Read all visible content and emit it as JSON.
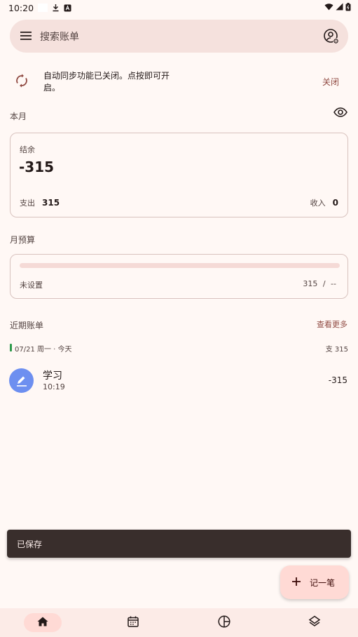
{
  "status_bar": {
    "time": "10:20",
    "icons": [
      "download-icon",
      "a-box-icon"
    ],
    "right_icons": [
      "wifi-icon",
      "signal-icon",
      "battery-icon"
    ]
  },
  "search": {
    "placeholder": "搜索账单",
    "menu_icon": "menu-icon",
    "account_icon": "account-settings-icon"
  },
  "sync_banner": {
    "message": "自动同步功能已关闭。点按即可开启。",
    "close_label": "关闭",
    "icon": "sync-icon"
  },
  "this_month": {
    "label": "本月",
    "balance_label": "结余",
    "balance": "-315",
    "expense_label": "支出",
    "expense": "315",
    "income_label": "收入",
    "income": "0",
    "eye_icon": "eye-icon"
  },
  "budget": {
    "label": "月预算",
    "status": "未设置",
    "ratio": "315 / --",
    "progress_fraction": 0
  },
  "recent": {
    "label": "近期账单",
    "more_label": "查看更多",
    "day_date": "07/21 周一 · 今天",
    "day_total": "支 315",
    "records": [
      {
        "title": "学习",
        "time": "10:19",
        "amount": "-315",
        "icon": "edit-icon"
      }
    ]
  },
  "snackbar": {
    "text": "已保存"
  },
  "fab": {
    "label": "记一笔",
    "icon": "plus-icon"
  },
  "bottom_nav": {
    "items": [
      {
        "icon": "home-icon",
        "active": true
      },
      {
        "icon": "calendar-icon",
        "active": false
      },
      {
        "icon": "chart-icon",
        "active": false
      },
      {
        "icon": "layers-icon",
        "active": false
      }
    ]
  },
  "colors": {
    "background": "#fff8f5",
    "accent": "#904a42",
    "search_bg": "#f5e1dd",
    "category_icon_bg": "#6d8ff0",
    "day_marker": "#2e9a4c"
  }
}
